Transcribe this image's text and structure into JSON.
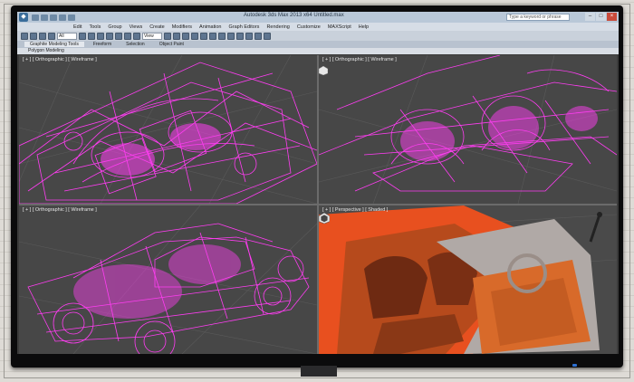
{
  "window": {
    "title": "Autodesk 3ds Max  2013 x64    Untitled.max",
    "search_placeholder": "Type a keyword or phrase"
  },
  "titlebar_buttons": [
    "minimize",
    "maximize",
    "close"
  ],
  "menu": [
    "Edit",
    "Tools",
    "Group",
    "Views",
    "Create",
    "Modifiers",
    "Animation",
    "Graph Editors",
    "Rendering",
    "Customize",
    "MAXScript",
    "Help"
  ],
  "toolbar": {
    "selection_filter": "All",
    "reference_coord": "View"
  },
  "ribbon": {
    "tabs": [
      "Graphite Modeling Tools",
      "Freeform",
      "Selection",
      "Object Paint"
    ],
    "active_tab": "Graphite Modeling Tools",
    "panel_label": "Polygon Modeling"
  },
  "viewports": {
    "top_left": {
      "label": "[ + ] [ Orthographic ] [ Wireframe ]",
      "mode": "wireframe"
    },
    "top_right": {
      "label": "[ + ] [ Orthographic ] [ Wireframe ]",
      "mode": "wireframe"
    },
    "bottom_left": {
      "label": "[ + ] [ Orthographic ] [ Wireframe ]",
      "mode": "wireframe"
    },
    "bottom_right": {
      "label": "[ + ] [ Perspective ] [ Shaded ]",
      "mode": "shaded",
      "active": true
    }
  },
  "colors": {
    "wire": "#ff3df2",
    "grid": "#5a5a5a",
    "viewport_bg": "#474747",
    "active_border": "#e4b43a",
    "shaded_body": "#e8501f",
    "shaded_interior": "#b64a1c",
    "shaded_panel": "#b0a9a6"
  },
  "icons": {
    "app": "app-logo-icon",
    "viewcube": "viewcube-icon"
  }
}
